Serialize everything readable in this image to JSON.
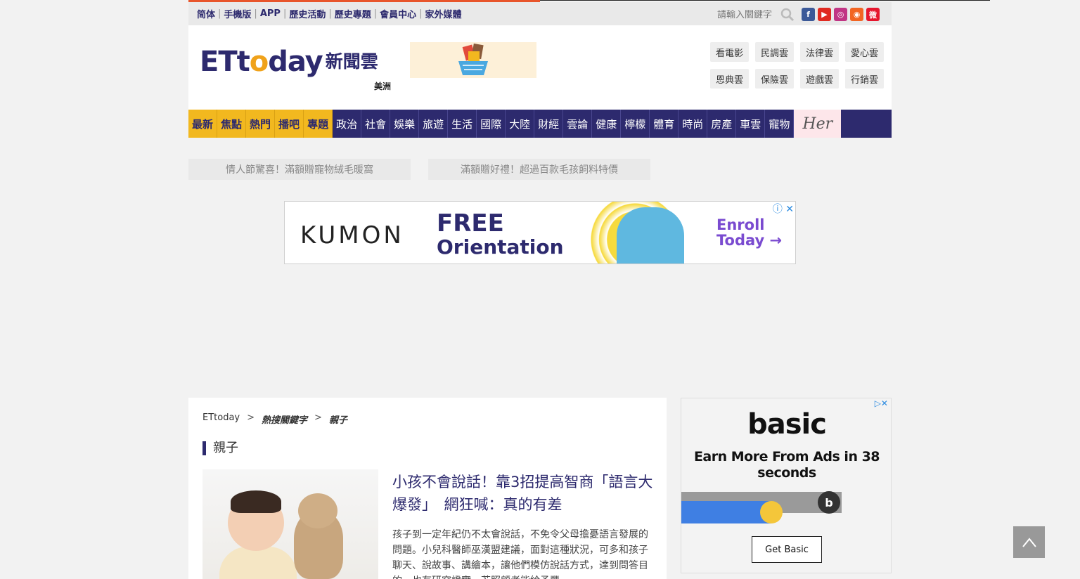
{
  "topbar": {
    "links": [
      "简体",
      "手機版",
      "APP",
      "歷史活動",
      "歷史專題",
      "會員中心",
      "家外媒體"
    ],
    "search_placeholder": "請輸入關鍵字",
    "social": [
      {
        "name": "facebook-icon",
        "glyph": "f",
        "color": "#3b5998"
      },
      {
        "name": "youtube-icon",
        "glyph": "▶",
        "color": "#e02a20"
      },
      {
        "name": "instagram-icon",
        "glyph": "◎",
        "color": "#c13584"
      },
      {
        "name": "rss-icon",
        "glyph": "◉",
        "color": "#f26522"
      },
      {
        "name": "weibo-icon",
        "glyph": "微",
        "color": "#e6162d"
      }
    ]
  },
  "header": {
    "logo_latin_1": "ETt",
    "logo_latin_o": "o",
    "logo_latin_2": "day",
    "logo_cn": "新聞雲",
    "region": "美洲",
    "clouds": [
      "看電影",
      "民調雲",
      "法律雲",
      "愛心雲",
      "恩典雲",
      "保險雲",
      "遊戲雲",
      "行銷雲"
    ]
  },
  "nav": {
    "featured": [
      "最新",
      "焦點",
      "熱門",
      "播吧",
      "專題"
    ],
    "items": [
      "政治",
      "社會",
      "娛樂",
      "旅遊",
      "生活",
      "國際",
      "大陸",
      "財經",
      "雲論",
      "健康",
      "檸檬",
      "體育",
      "時尚",
      "房產",
      "車雲",
      "寵物"
    ],
    "her": "Her"
  },
  "promos": [
    "情人節驚喜！滿額贈寵物絨毛暖窩",
    "滿額贈好禮！超過百款毛孩飼料特價"
  ],
  "banner_ad": {
    "brand": "KUMON",
    "line1": "FREE",
    "line2": "Orientation",
    "cta1": "Enroll",
    "cta2": "Today →",
    "close": "ⓘ ✕"
  },
  "breadcrumb": {
    "home": "ETtoday",
    "sep": ">",
    "level1": "熱搜關鍵字",
    "level2": "親子"
  },
  "section_title": "親子",
  "article": {
    "headline": "小孩不會說話！靠3招提高智商「語言大爆發」　網狂喊：真的有差",
    "summary": "孩子到一定年紀仍不太會說話，不免令父母擔憂語言發展的問題。小兒科醫師巫漢盟建議，面對這種狀況，可多和孩子聊天、說故事、講繪本，讓他們模仿說話方式，達到問答目的，也有研究證實，若照顧者能給予豐"
  },
  "side_ad": {
    "logo": "basic",
    "headline": "Earn More From Ads in 38 seconds",
    "progress": 0.56,
    "knob_glyph": "b",
    "button": "Get Basic",
    "close": "▷✕"
  },
  "back_to_top": "↑"
}
